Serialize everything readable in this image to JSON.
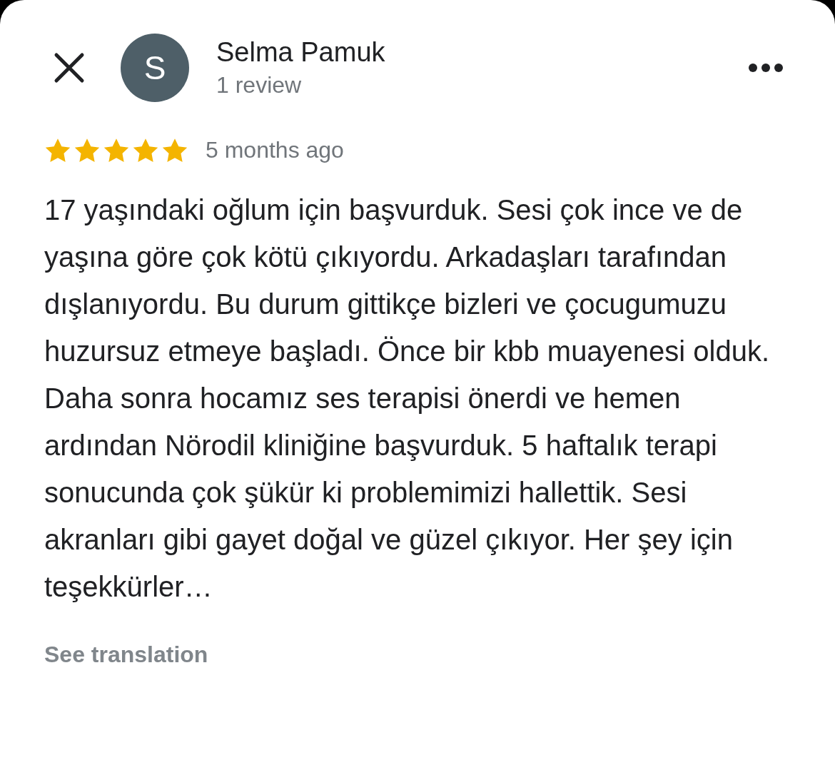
{
  "reviewer": {
    "initial": "S",
    "name": "Selma Pamuk",
    "review_count": "1 review"
  },
  "review": {
    "stars": 5,
    "time": "5 months ago",
    "text": "17 yaşındaki oğlum için başvurduk. Sesi çok ince ve de yaşına göre çok kötü çıkıyordu. Arkadaşları tarafından dışlanıyordu. Bu durum gittikçe bizleri ve çocugumuzu huzursuz etmeye başladı. Önce bir kbb muayenesi olduk. Daha sonra hocamız ses terapisi önerdi ve hemen ardından Nörodil kliniğine başvurduk. 5 haftalık terapi sonucunda çok şükür ki problemimizi hallettik. Sesi akranları gibi gayet doğal ve güzel çıkıyor. Her şey için teşekkürler…"
  },
  "see_translation": "See translation"
}
